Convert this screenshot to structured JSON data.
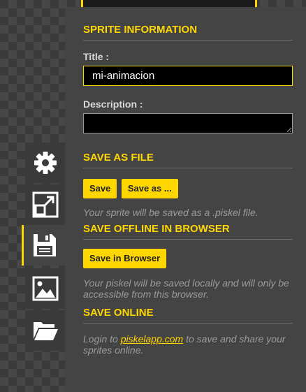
{
  "sprite_info": {
    "title": "SPRITE INFORMATION",
    "title_label": "Title :",
    "title_value": "mi-animacion",
    "description_label": "Description :",
    "description_value": ""
  },
  "save_as_file": {
    "title": "SAVE AS FILE",
    "save_button": "Save",
    "save_as_button": "Save as ...",
    "description": "Your sprite will be saved as a .piskel file."
  },
  "save_offline": {
    "title": "SAVE OFFLINE IN BROWSER",
    "button": "Save in Browser",
    "description": "Your piskel will be saved locally and will only be accessible from this browser."
  },
  "save_online": {
    "title": "SAVE ONLINE",
    "login_text": "Login to",
    "login_link": "piskelapp.com",
    "suffix_text": "to save and share your sprites online."
  },
  "toolbar": {
    "items": [
      {
        "icon": "gear-icon",
        "active": false
      },
      {
        "icon": "resize-icon",
        "active": false
      },
      {
        "icon": "floppy-disk-icon",
        "active": true
      },
      {
        "icon": "image-export-icon",
        "active": false
      },
      {
        "icon": "folder-open-icon",
        "active": false
      }
    ]
  },
  "colors": {
    "accent": "#ffd700",
    "panel": "#444444",
    "description_text": "#9b9b9b"
  }
}
